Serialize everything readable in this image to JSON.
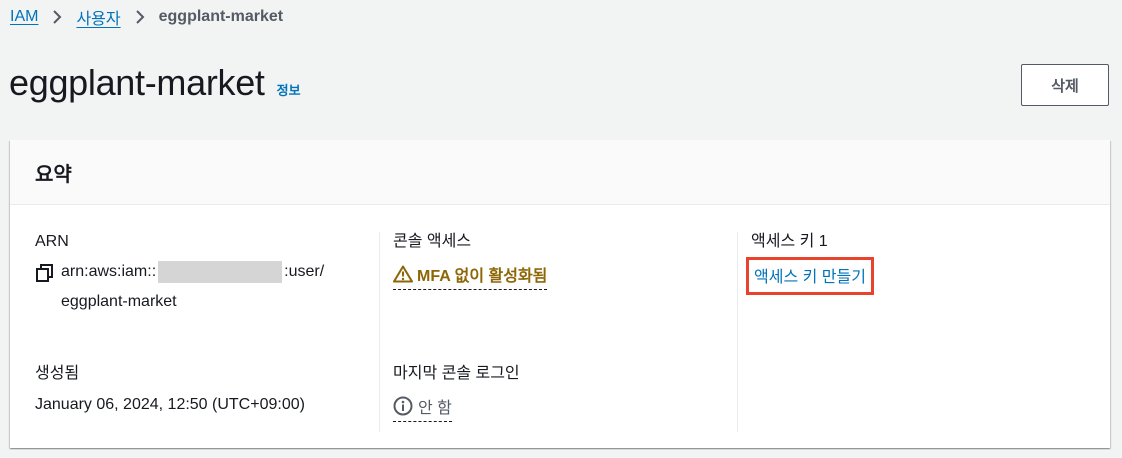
{
  "breadcrumb": {
    "items": [
      {
        "label": "IAM"
      },
      {
        "label": "사용자"
      }
    ],
    "current": "eggplant-market"
  },
  "page": {
    "title": "eggplant-market",
    "info_link": "정보",
    "delete_button": "삭제"
  },
  "summary": {
    "heading": "요약",
    "arn": {
      "label": "ARN",
      "prefix": "arn:aws:iam::",
      "suffix": ":user/",
      "line2": "eggplant-market"
    },
    "created": {
      "label": "생성됨",
      "value": "January 06, 2024, 12:50 (UTC+09:00)"
    },
    "console_access": {
      "label": "콘솔 액세스",
      "status": "MFA 없이 활성화됨"
    },
    "last_console_login": {
      "label": "마지막 콘솔 로그인",
      "value": "안 함"
    },
    "access_key": {
      "label": "액세스 키 1",
      "create_link": "액세스 키 만들기"
    }
  },
  "icons": {
    "separator": "chevron-right-icon",
    "copy": "copy-icon",
    "warning": "warning-icon",
    "info": "info-icon"
  },
  "colors": {
    "link": "#0073bb",
    "warning": "#8d6605",
    "highlight_box": "#e8442d",
    "background": "#f2f3f3"
  }
}
